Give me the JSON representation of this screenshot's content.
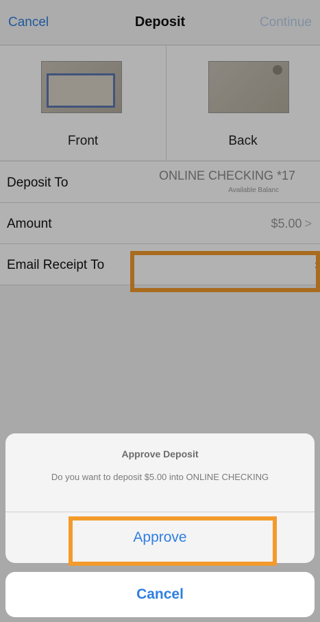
{
  "nav": {
    "cancel_label": "Cancel",
    "title": "Deposit",
    "continue_label": "Continue"
  },
  "checks": {
    "front_label": "Front",
    "back_label": "Back"
  },
  "form": {
    "deposit_to": {
      "label": "Deposit To",
      "account": "ONLINE CHECKING *17",
      "sub": "Available Balanc"
    },
    "amount": {
      "label": "Amount",
      "value": "$5.00",
      "chevron": ">"
    },
    "email_receipt": {
      "label": "Email Receipt To",
      "value": "",
      "trail": "›"
    }
  },
  "action_sheet": {
    "title": "Approve Deposit",
    "message": "Do you want to deposit $5.00 into ONLINE CHECKING",
    "approve_label": "Approve",
    "cancel_label": "Cancel"
  },
  "colors": {
    "accent": "#2f7fe0",
    "highlight": "#f39a2b"
  }
}
